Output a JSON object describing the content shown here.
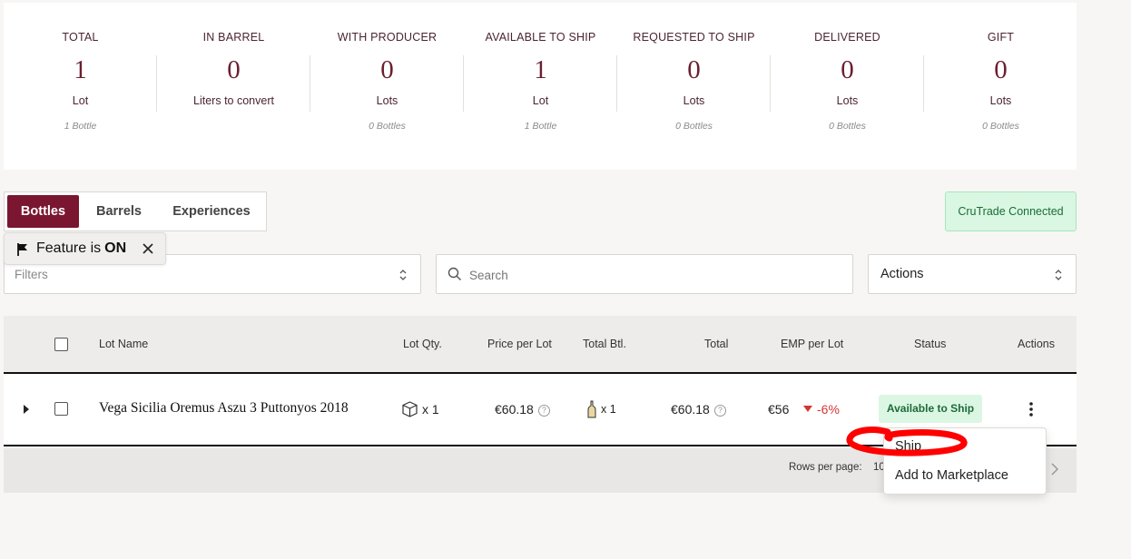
{
  "summary": [
    {
      "label": "TOTAL",
      "value": "1",
      "unit": "Lot",
      "sub": "1 Bottle"
    },
    {
      "label": "IN BARREL",
      "value": "0",
      "unit": "Liters to convert",
      "sub": ""
    },
    {
      "label": "WITH PRODUCER",
      "value": "0",
      "unit": "Lots",
      "sub": "0 Bottles"
    },
    {
      "label": "AVAILABLE TO SHIP",
      "value": "1",
      "unit": "Lot",
      "sub": "1 Bottle"
    },
    {
      "label": "REQUESTED TO SHIP",
      "value": "0",
      "unit": "Lots",
      "sub": "0 Bottles"
    },
    {
      "label": "DELIVERED",
      "value": "0",
      "unit": "Lots",
      "sub": "0 Bottles"
    },
    {
      "label": "GIFT",
      "value": "0",
      "unit": "Lots",
      "sub": "0 Bottles"
    }
  ],
  "tabs": [
    "Bottles",
    "Barrels",
    "Experiences"
  ],
  "cru_badge": "CruTrade Connected",
  "feature": {
    "text": "Feature is",
    "state": "ON"
  },
  "filters": {
    "placeholder": "Filters"
  },
  "search": {
    "placeholder": "Search"
  },
  "actions_select": {
    "value": "Actions"
  },
  "table": {
    "headers": [
      "Lot Name",
      "Lot Qty.",
      "Price per Lot",
      "Total Btl.",
      "Total",
      "EMP per Lot",
      "Status",
      "Actions"
    ],
    "row": {
      "lot_name": "Vega Sicilia Oremus Aszu 3 Puttonyos 2018",
      "qty": "x 1",
      "price": "€60.18",
      "total_btl": "x 1",
      "total": "€60.18",
      "emp": "€56",
      "emp_change": "-6%",
      "status": "Available to Ship"
    }
  },
  "footer": {
    "rows_per_page_label": "Rows per page:",
    "rows_per_page_value": "10"
  },
  "row_menu": [
    "Ship",
    "Add to Marketplace"
  ],
  "colors": {
    "brand": "#7a1630",
    "success_bg": "#dcf6e4",
    "negative": "#d23636",
    "annotation": "#ff0000"
  }
}
